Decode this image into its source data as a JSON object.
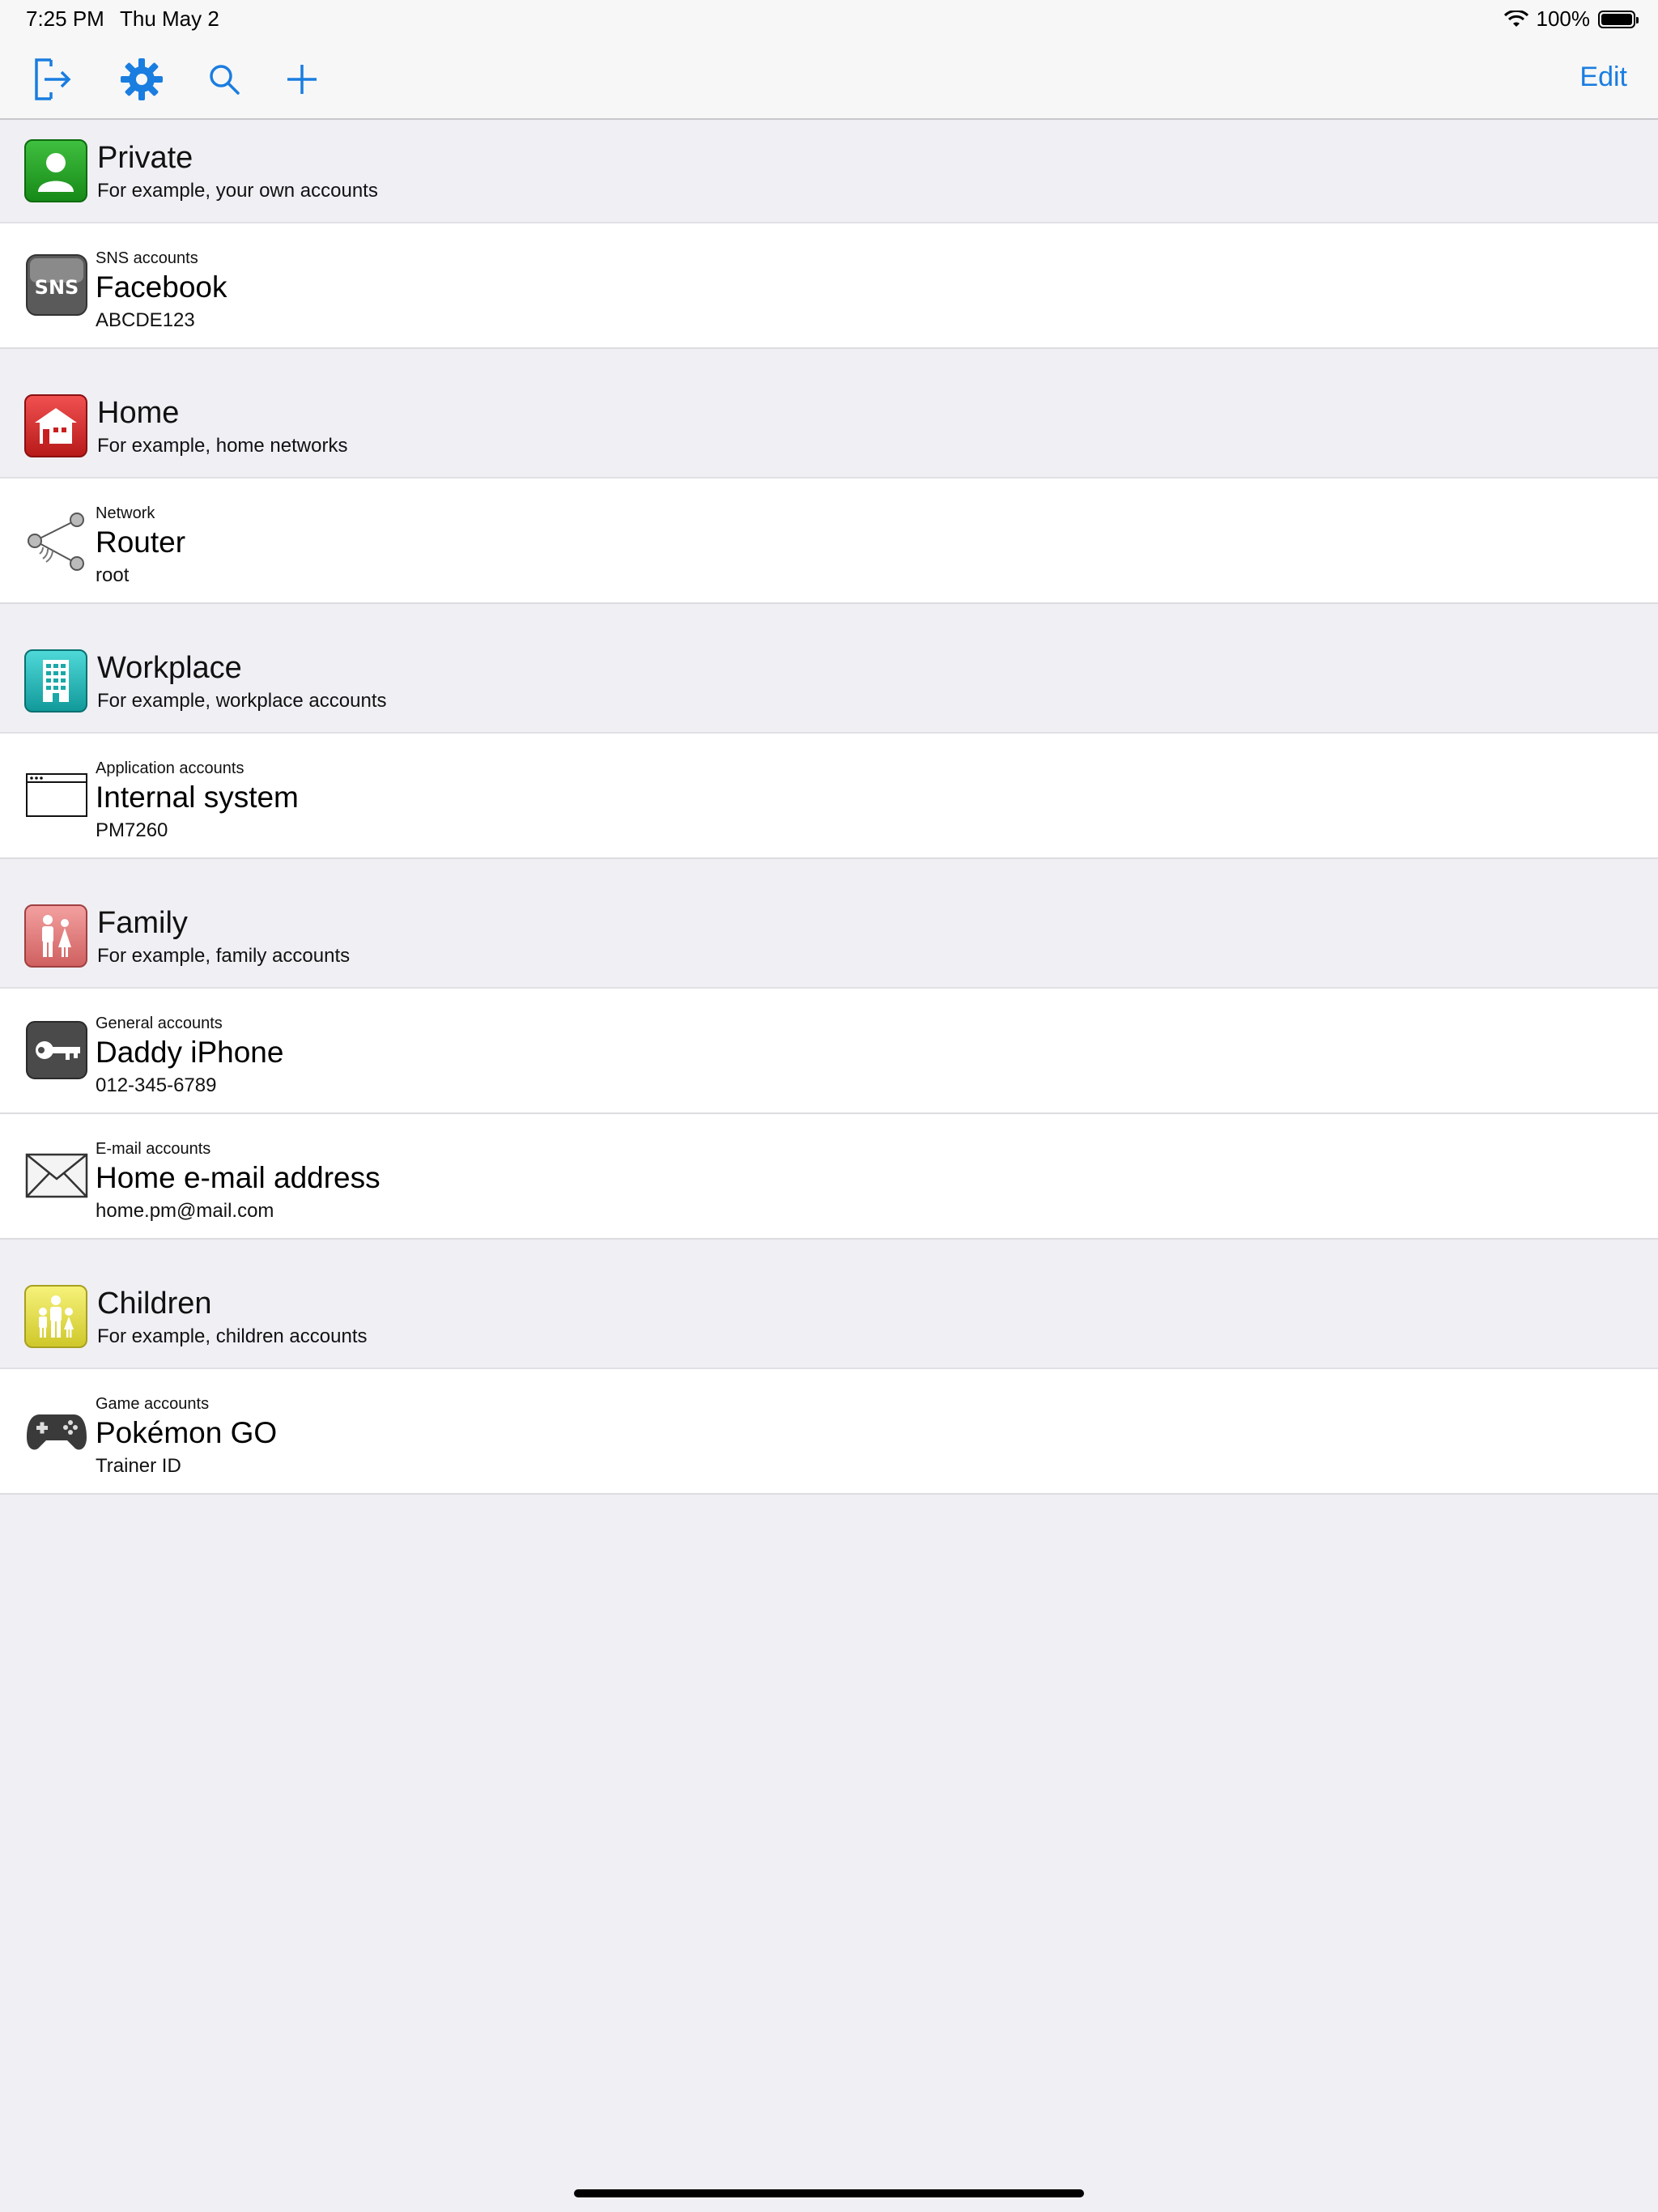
{
  "status": {
    "time": "7:25 PM",
    "date": "Thu May 2",
    "battery": "100%",
    "battery_level": 1.0
  },
  "toolbar": {
    "icons": [
      "exit-icon",
      "gear-icon",
      "search-icon",
      "plus-icon"
    ],
    "edit_label": "Edit",
    "accent": "#1a7de0"
  },
  "groups": [
    {
      "title": "Private",
      "subtitle": "For example, your own accounts",
      "icon": "person-icon",
      "color": "#2a9a2a",
      "items": [
        {
          "category": "SNS accounts",
          "name": "Facebook",
          "value": "ABCDE123",
          "icon": "sns-icon"
        }
      ]
    },
    {
      "title": "Home",
      "subtitle": "For example, home networks",
      "icon": "house-icon",
      "color": "#d92c2c",
      "items": [
        {
          "category": "Network",
          "name": "Router",
          "value": "root",
          "icon": "network-icon"
        }
      ]
    },
    {
      "title": "Workplace",
      "subtitle": "For example, workplace accounts",
      "icon": "building-icon",
      "color": "#1fb5b5",
      "items": [
        {
          "category": "Application accounts",
          "name": "Internal system",
          "value": "PM7260",
          "icon": "app-window-icon"
        }
      ]
    },
    {
      "title": "Family",
      "subtitle": "For example, family accounts",
      "icon": "family-icon",
      "color": "#e07a7a",
      "items": [
        {
          "category": "General accounts",
          "name": "Daddy iPhone",
          "value": "012-345-6789",
          "icon": "key-icon"
        },
        {
          "category": "E-mail accounts",
          "name": "Home e-mail address",
          "value": "home.pm@mail.com",
          "icon": "envelope-icon"
        }
      ]
    },
    {
      "title": "Children",
      "subtitle": "For example, children accounts",
      "icon": "children-icon",
      "color": "#e8e24a",
      "items": [
        {
          "category": "Game accounts",
          "name": "Pokémon GO",
          "value": "Trainer ID",
          "icon": "gamepad-icon"
        }
      ]
    }
  ]
}
